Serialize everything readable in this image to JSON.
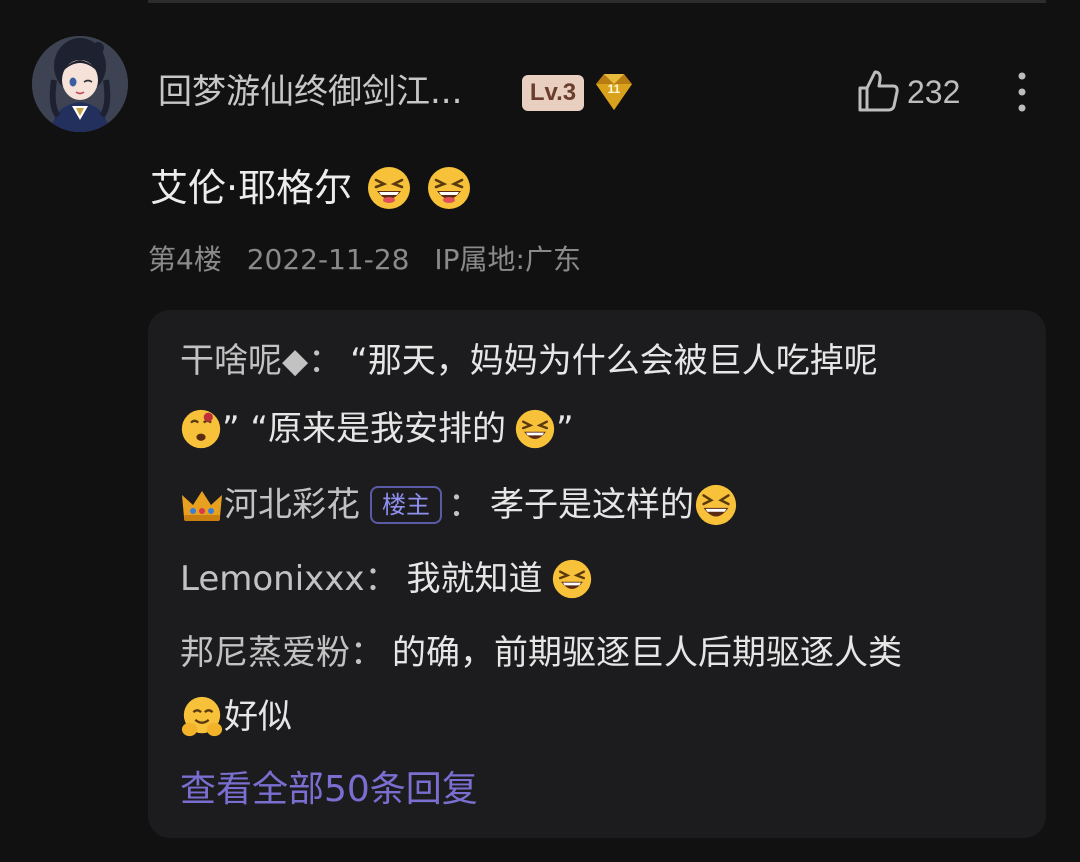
{
  "comment": {
    "username": "回梦游仙终御剑江...",
    "level": "Lv.3",
    "medal_number": "11",
    "like_count": "232",
    "text": "艾伦·耶格尔",
    "text_emojis": [
      "grin-squint-emoji",
      "grin-squint-emoji"
    ],
    "floor": "第4楼",
    "date": "2022-11-28",
    "ip_location": "IP属地:广东"
  },
  "replies": [
    {
      "name": "干啥呢◆",
      "colon": "：",
      "text_line1": "“那天，妈妈为什么会被巨人吃掉呢",
      "text_line2a": "” “原来是我安排的",
      "text_line2b": "”"
    },
    {
      "name": "河北彩花",
      "tag": "楼主",
      "colon": "：",
      "text": "孝子是这样的"
    },
    {
      "name": "Lemonixxx",
      "colon": "：",
      "text": "我就知道"
    },
    {
      "name": "邦尼蒸爱粉",
      "colon": "：",
      "text_line1": "的确，前期驱逐巨人后期驱逐人类",
      "text_line2": "好似"
    }
  ],
  "view_all": "查看全部50条回复",
  "colors": {
    "background": "#111111",
    "reply_box": "#1c1c1e",
    "link": "#7a6fd0",
    "level_badge": "#e8cfc0"
  }
}
